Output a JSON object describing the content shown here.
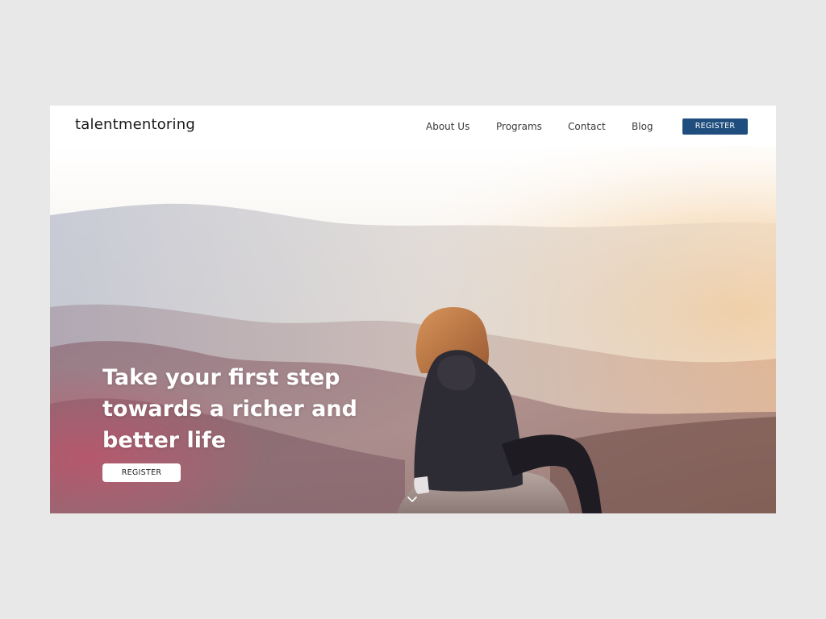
{
  "brand": {
    "logo": "talentmentoring"
  },
  "nav": {
    "links": [
      "About Us",
      "Programs",
      "Contact",
      "Blog"
    ],
    "register_label": "REGISTER"
  },
  "hero": {
    "headline_lines": [
      "Take your first step",
      "towards a richer and",
      "better life"
    ],
    "register_label": "REGISTER",
    "scroll_icon": "chevron-down-icon"
  },
  "colors": {
    "page_background": "#e8e8e8",
    "nav_background": "#ffffff",
    "accent": "#1f4d7d",
    "headline_text": "#ffffff"
  }
}
